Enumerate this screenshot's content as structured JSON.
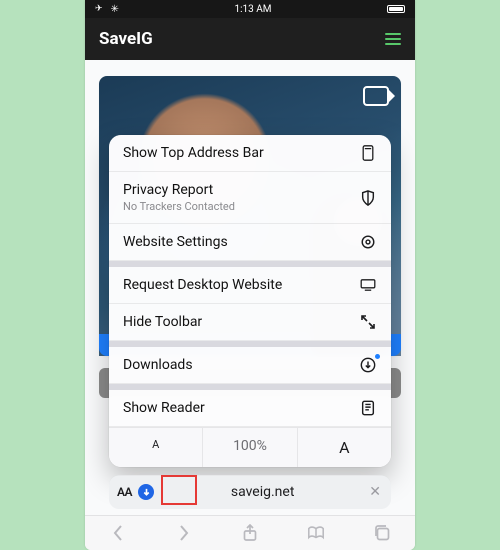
{
  "status": {
    "time": "1:13 AM"
  },
  "header": {
    "brand": "SaveIG"
  },
  "menu": {
    "show_top": "Show Top Address Bar",
    "privacy": "Privacy Report",
    "privacy_sub": "No Trackers Contacted",
    "website_settings": "Website Settings",
    "request_desktop": "Request Desktop Website",
    "hide_toolbar": "Hide Toolbar",
    "downloads": "Downloads",
    "show_reader": "Show Reader",
    "zoom": {
      "small": "A",
      "value": "100%",
      "big": "A"
    }
  },
  "urlbar": {
    "aa": "AA",
    "domain": "saveig.net"
  }
}
